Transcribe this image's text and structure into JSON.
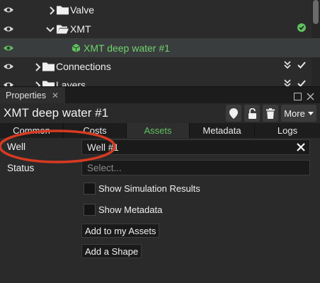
{
  "tree": {
    "items": [
      {
        "label": "Valve",
        "type": "folder-closed"
      },
      {
        "label": "XMT",
        "type": "folder-open"
      },
      {
        "label": "XMT deep water #1",
        "type": "asset",
        "selected": true
      },
      {
        "label": "Connections",
        "type": "folder-closed"
      },
      {
        "label": "Layers",
        "type": "folder-closed"
      }
    ]
  },
  "panel": {
    "tab_label": "Properties",
    "title": "XMT deep water #1",
    "more_label": "More"
  },
  "subtabs": [
    "Common",
    "Costs",
    "Assets",
    "Metadata",
    "Logs"
  ],
  "active_subtab": "Assets",
  "form": {
    "well_label": "Well",
    "well_value": "Well #1",
    "status_label": "Status",
    "status_placeholder": "Select...",
    "show_sim_label": "Show Simulation Results",
    "show_meta_label": "Show Metadata",
    "add_assets_label": "Add to my Assets",
    "add_shape_label": "Add a Shape"
  },
  "colors": {
    "accent_green": "#5fc35f",
    "annotation_red": "#d63a22"
  }
}
